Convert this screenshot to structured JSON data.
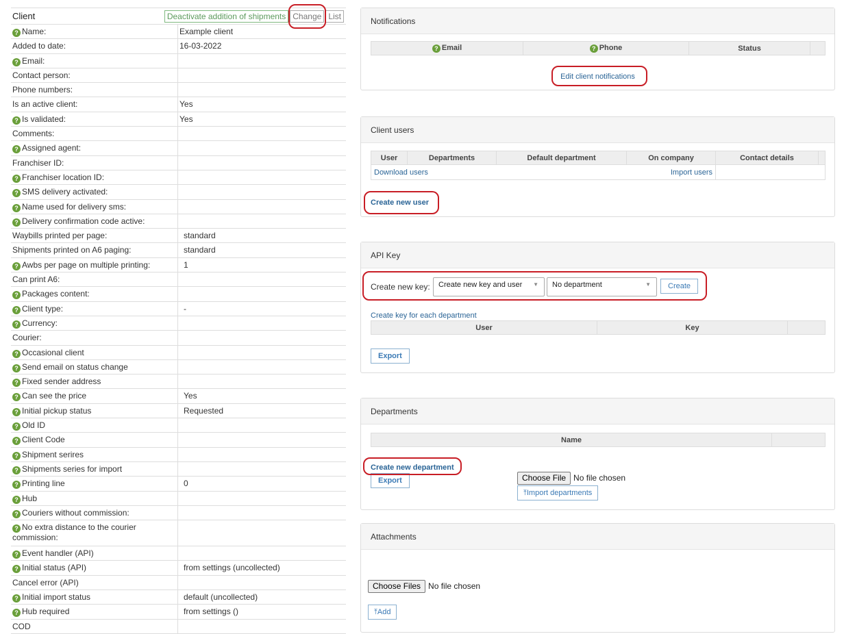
{
  "client": {
    "title": "Client",
    "deactivate_label": "Deactivate addition of shipments",
    "change_label": "Change",
    "list_label": "List",
    "rows": [
      {
        "label": "Name:",
        "help": true,
        "value": "Example client"
      },
      {
        "label": "Added to date:",
        "help": false,
        "value": "16-03-2022"
      },
      {
        "label": "Email:",
        "help": true,
        "value": ""
      },
      {
        "label": "Contact person:",
        "help": false,
        "value": ""
      },
      {
        "label": "Phone numbers:",
        "help": false,
        "value": ""
      },
      {
        "label": "Is an active client:",
        "help": false,
        "value": "Yes"
      },
      {
        "label": "Is validated:",
        "help": true,
        "value": "Yes"
      },
      {
        "label": "Comments:",
        "help": false,
        "value": ""
      },
      {
        "label": "Assigned agent:",
        "help": true,
        "value": ""
      },
      {
        "label": "Franchiser ID:",
        "help": false,
        "value": ""
      },
      {
        "label": "Franchiser location ID:",
        "help": true,
        "value": ""
      },
      {
        "label": "SMS delivery activated:",
        "help": true,
        "value": ""
      },
      {
        "label": "Name used for delivery sms:",
        "help": true,
        "value": ""
      },
      {
        "label": "Delivery confirmation code active:",
        "help": true,
        "value": ""
      },
      {
        "label": "Waybills printed per page:",
        "help": false,
        "value": "standard",
        "indent": true
      },
      {
        "label": "Shipments printed on A6 paging:",
        "help": false,
        "value": "standard",
        "indent": true
      },
      {
        "label": "Awbs per page on multiple printing:",
        "help": true,
        "value": "1",
        "indent": true
      },
      {
        "label": "Can print A6:",
        "help": false,
        "value": ""
      },
      {
        "label": "Packages content:",
        "help": true,
        "value": ""
      },
      {
        "label": "Client type:",
        "help": true,
        "value": "-",
        "indent": true
      },
      {
        "label": "Currency:",
        "help": true,
        "value": ""
      },
      {
        "label": "Courier:",
        "help": false,
        "value": ""
      },
      {
        "label": "Occasional client",
        "help": true,
        "value": ""
      },
      {
        "label": "Send email on status change",
        "help": true,
        "value": ""
      },
      {
        "label": "Fixed sender address",
        "help": true,
        "value": ""
      },
      {
        "label": "Can see the price",
        "help": true,
        "value": "Yes",
        "indent": true
      },
      {
        "label": "Initial pickup status",
        "help": true,
        "value": "Requested",
        "indent": true
      },
      {
        "label": "Old ID",
        "help": true,
        "value": ""
      },
      {
        "label": "Client Code",
        "help": true,
        "value": ""
      },
      {
        "label": "Shipment serires",
        "help": true,
        "value": ""
      },
      {
        "label": "Shipments series for import",
        "help": true,
        "value": ""
      },
      {
        "label": "Printing line",
        "help": true,
        "value": "0",
        "indent": true
      },
      {
        "label": "Hub",
        "help": true,
        "value": ""
      },
      {
        "label": "Couriers without commission:",
        "help": true,
        "value": ""
      },
      {
        "label": "No extra distance to the courier commission:",
        "help": true,
        "value": "",
        "tall": true
      },
      {
        "label": "Event handler (API)",
        "help": true,
        "value": ""
      },
      {
        "label": "Initial status (API)",
        "help": true,
        "value": "from settings (uncollected)",
        "indent": true
      },
      {
        "label": "Cancel error (API)",
        "help": false,
        "value": ""
      },
      {
        "label": "Initial import status",
        "help": true,
        "value": "default (uncollected)",
        "indent": true
      },
      {
        "label": "Hub required",
        "help": true,
        "value": "from settings ()",
        "indent": true
      },
      {
        "label": "COD",
        "help": false,
        "value": ""
      }
    ]
  },
  "notifications": {
    "title": "Notifications",
    "col_email": "Email",
    "col_phone": "Phone",
    "col_status": "Status",
    "edit_link": "Edit client notifications"
  },
  "client_users": {
    "title": "Client users",
    "columns": [
      "User",
      "Departments",
      "Default department",
      "On company",
      "Contact details"
    ],
    "download_link": "Download users",
    "import_link": "Import users",
    "create_link": "Create new user"
  },
  "api_key": {
    "title": "API Key",
    "create_label": "Create new key:",
    "mode_selected": "Create new key and user",
    "department_selected": "No department",
    "create_button": "Create",
    "each_dept_link": "Create key for each department",
    "columns": [
      "User",
      "Key"
    ],
    "export_button": "Export"
  },
  "departments": {
    "title": "Departments",
    "column_name": "Name",
    "create_link": "Create new department",
    "export_button": "Export",
    "choose_file": "Choose File",
    "no_file": "No file chosen",
    "import_button": "Import departments"
  },
  "attachments": {
    "title": "Attachments",
    "choose_files": "Choose Files",
    "no_file": "No file chosen",
    "add_button": "Add"
  },
  "colors": {
    "help_icon": "#6a9f3a",
    "link": "#2a6496",
    "highlight_ring": "#c81d25",
    "green_button": "#5c9a5c"
  }
}
